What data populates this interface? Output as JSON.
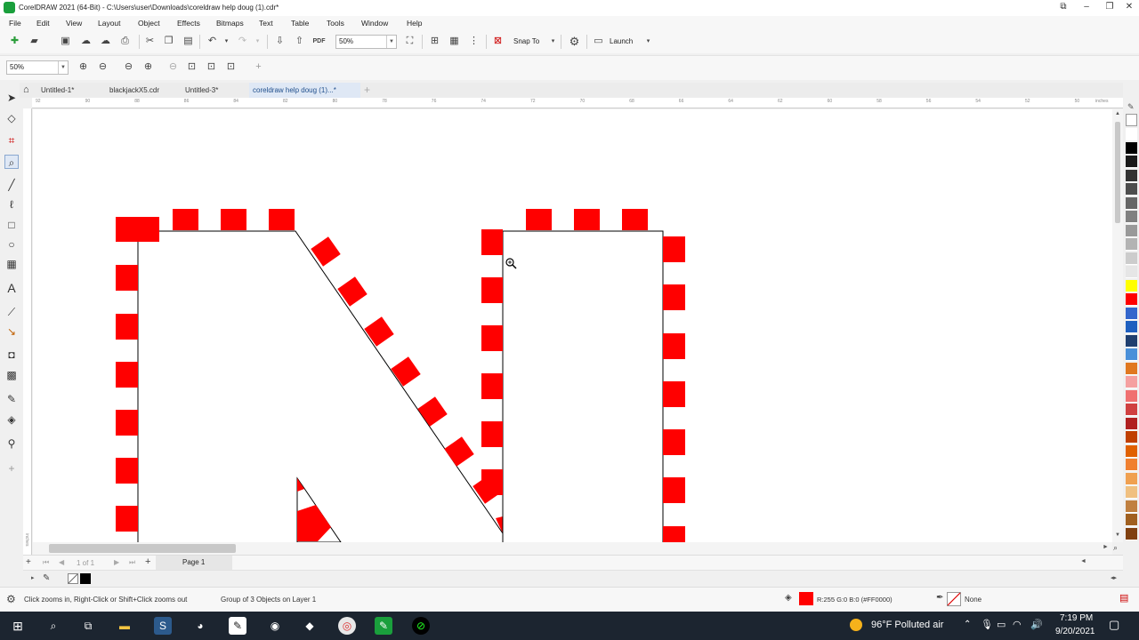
{
  "window": {
    "title": "CorelDRAW 2021 (64-Bit) - C:\\Users\\user\\Downloads\\coreldraw help doug (1).cdr*"
  },
  "menu": [
    "File",
    "Edit",
    "View",
    "Layout",
    "Object",
    "Effects",
    "Bitmaps",
    "Text",
    "Table",
    "Tools",
    "Window",
    "Help"
  ],
  "toolbar": {
    "zoom_value": "50%",
    "snap_label": "Snap To",
    "launch_label": "Launch"
  },
  "zoombar": {
    "zoom_value": "50%"
  },
  "tabs": [
    {
      "label": "Untitled-1*",
      "active": false
    },
    {
      "label": "blackjackX5.cdr",
      "active": false
    },
    {
      "label": "Untitled-3*",
      "active": false
    },
    {
      "label": "coreldraw help doug (1)...*",
      "active": true
    }
  ],
  "ruler": {
    "unit_label": "inches",
    "h_ticks": [
      "92",
      "90",
      "88",
      "86",
      "84",
      "82",
      "80",
      "78",
      "76",
      "74",
      "72",
      "70",
      "68",
      "66",
      "64",
      "62",
      "60",
      "58",
      "56",
      "54",
      "52",
      "50"
    ],
    "v_unit_label": "inches"
  },
  "pagebar": {
    "page_count": "1 of 1",
    "page_tab": "Page 1"
  },
  "statusbar": {
    "hint": "Click zooms in, Right-Click or Shift+Click zooms out",
    "selection": "Group of 3 Objects on Layer 1",
    "fill_value": "R:255 G:0 B:0 (#FF0000)",
    "outline_value": "None"
  },
  "taskbar": {
    "weather": "96°F  Polluted air",
    "time": "7:19 PM",
    "date": "9/20/2021"
  },
  "colors": {
    "accent": "#ff0000",
    "palette": [
      "#ffffff",
      "#000000",
      "#1a1a1a",
      "#333333",
      "#4d4d4d",
      "#666666",
      "#808080",
      "#999999",
      "#b3b3b3",
      "#cccccc",
      "#e6e6e6",
      "#ffff00",
      "#ff0000",
      "#3366cc",
      "#1e5fbf",
      "#1f3f6f",
      "#4a90d9",
      "#e07820",
      "#f5a0a0",
      "#f07070",
      "#d04040",
      "#b02020",
      "#c04000",
      "#e06000",
      "#f08030",
      "#f0a050",
      "#f0c080",
      "#c08040",
      "#a06020",
      "#804010"
    ]
  }
}
